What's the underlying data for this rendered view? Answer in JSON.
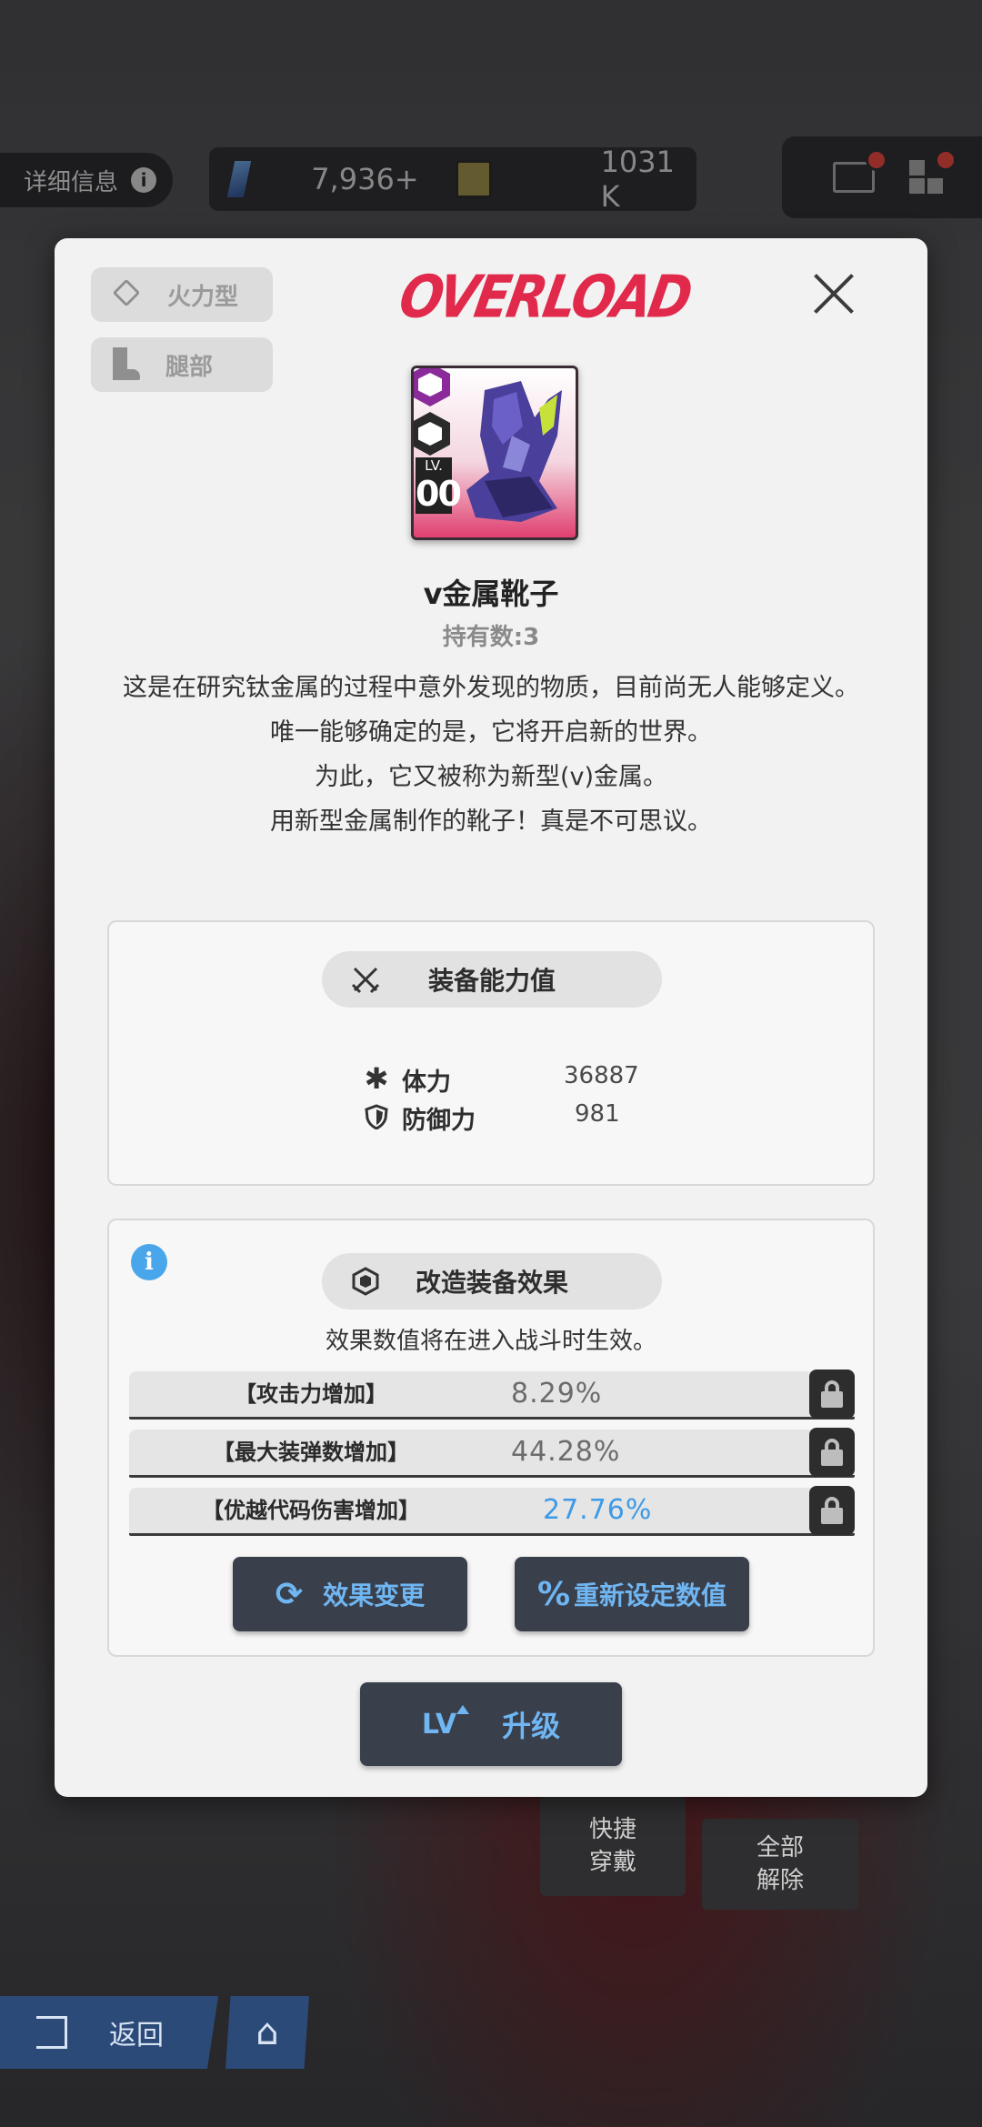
{
  "background": {
    "top_bar": {
      "info_label": "详细信息",
      "currency_1": "7,936",
      "currency_1_plus": "+",
      "currency_2": "1031 K"
    },
    "quick_equip": "快捷\n穿戴",
    "unequip_all": "全部\n解除",
    "back_label": "返回",
    "icons": [
      "info-icon",
      "gem-icon",
      "card-icon",
      "mail-icon",
      "menu-grid-icon",
      "back-icon",
      "home-icon"
    ]
  },
  "modal": {
    "tags": {
      "type": "火力型",
      "slot": "腿部"
    },
    "logo_text": "OVERLOAD",
    "item": {
      "level_label": "LV.",
      "level": "00",
      "name": "v金属靴子",
      "owned": "持有数:3"
    },
    "description": [
      "这是在研究钛金属的过程中意外发现的物质，目前尚无人能够定义。",
      "唯一能够确定的是，它将开启新的世界。",
      "为此，它又被称为新型(v)金属。",
      "用新型金属制作的靴子！真是不可思议。"
    ],
    "stats": {
      "title": "装备能力值",
      "rows": [
        {
          "label": "体力",
          "value": "36887",
          "icon": "asterisk-icon"
        },
        {
          "label": "防御力",
          "value": "981",
          "icon": "shield-icon"
        }
      ]
    },
    "mods": {
      "title": "改造装备效果",
      "note": "效果数值将在进入战斗时生效。",
      "rows": [
        {
          "label": "【攻击力增加】",
          "value": "8.29%"
        },
        {
          "label": "【最大装弹数增加】",
          "value": "44.28%"
        },
        {
          "label": "【优越代码伤害增加】",
          "value": "27.76%"
        }
      ],
      "change_label": "效果变更",
      "reset_label": "重新设定数值"
    },
    "upgrade": {
      "icon_text": "LV",
      "label": "升级"
    },
    "colors": {
      "accent": "#e0294b",
      "button_text": "#6fb6f2",
      "highlight_value": "#3d9ae6"
    }
  }
}
